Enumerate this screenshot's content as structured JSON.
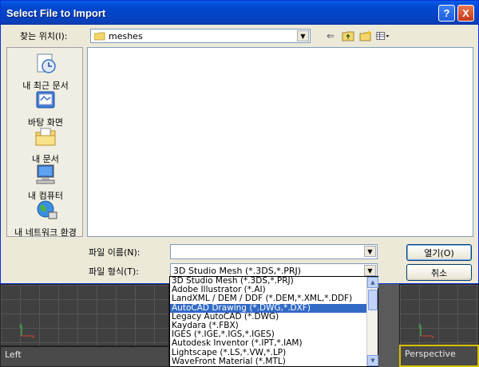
{
  "dialog": {
    "title": "Select File to Import",
    "help_label": "?",
    "close_label": "X",
    "look_in_label": "찾는 위치(I):",
    "look_in_value": "meshes",
    "file_name_label": "파일 이름(N):",
    "file_name_value": "",
    "file_type_label": "파일 형식(T):",
    "file_type_value": "3D Studio Mesh (*.3DS,*.PRJ)",
    "open_label": "열기(O)",
    "cancel_label": "취소"
  },
  "places": [
    {
      "label": "내 최근 문서",
      "icon": "recent-documents-icon"
    },
    {
      "label": "바탕 화면",
      "icon": "desktop-icon"
    },
    {
      "label": "내 문서",
      "icon": "my-documents-icon"
    },
    {
      "label": "내 컴퓨터",
      "icon": "my-computer-icon"
    },
    {
      "label": "내 네트워크 환경",
      "icon": "network-places-icon"
    }
  ],
  "file_types": [
    "3D Studio Mesh (*.3DS,*.PRJ)",
    "Adobe Illustrator (*.AI)",
    "LandXML / DEM / DDF (*.DEM,*.XML,*.DDF)",
    "AutoCAD Drawing (*.DWG,*.DXF)",
    "Legacy AutoCAD (*.DWG)",
    "Kaydara (*.FBX)",
    "IGES (*.IGE,*.IGS,*.IGES)",
    "Autodesk Inventor (*.IPT,*.IAM)",
    "Lightscape (*.LS,*.VW,*.LP)",
    "WaveFront Material (*.MTL)"
  ],
  "selected_file_type_index": 3,
  "viewports": {
    "left_label": "Left",
    "perspective_label": "Perspective"
  },
  "colors": {
    "title_blue": "#0047cf",
    "selection": "#316ac5",
    "active_viewport": "#d8c000"
  }
}
